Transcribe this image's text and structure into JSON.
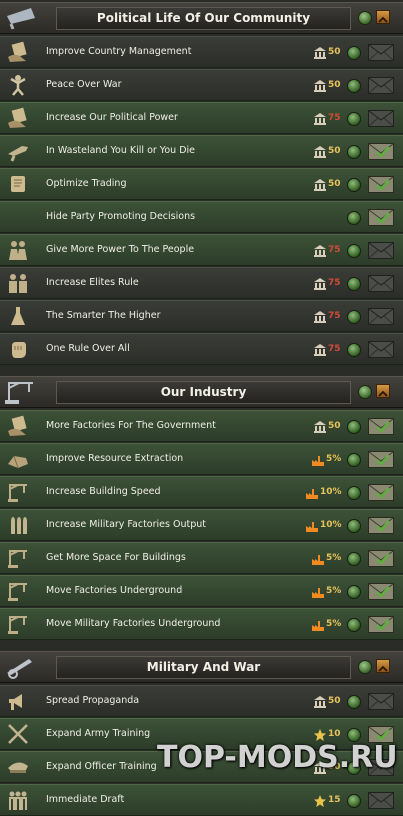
{
  "sections": [
    {
      "title": "Political Life Of Our Community",
      "emblem": "speaker-emblem-icon",
      "rows": [
        {
          "label": "Improve Country Management",
          "icon": "hand-document-icon",
          "cost_icon": "political-power-icon",
          "cost": "50",
          "cost_color": "#e5c25b",
          "envelope": "closed",
          "alt": true
        },
        {
          "label": "Peace Over War",
          "icon": "peace-figure-icon",
          "cost_icon": "political-power-icon",
          "cost": "50",
          "cost_color": "#e5c25b",
          "envelope": "closed",
          "alt": true
        },
        {
          "label": "Increase Our Political Power",
          "icon": "hand-document-icon",
          "cost_icon": "political-power-icon",
          "cost": "75",
          "cost_color": "#d24a38",
          "envelope": "closed",
          "alt": false
        },
        {
          "label": "In Wasteland You Kill or You Die",
          "icon": "weapon-icon",
          "cost_icon": "political-power-icon",
          "cost": "50",
          "cost_color": "#e5c25b",
          "envelope": "open",
          "alt": false
        },
        {
          "label": "Optimize Trading",
          "icon": "scroll-icon",
          "cost_icon": "political-power-icon",
          "cost": "50",
          "cost_color": "#e5c25b",
          "envelope": "open",
          "alt": false
        },
        {
          "label": "Hide Party Promoting Decisions",
          "icon": "",
          "cost_icon": "",
          "cost": "",
          "cost_color": "#e5c25b",
          "envelope": "open",
          "alt": false
        },
        {
          "label": "Give More Power To The People",
          "icon": "crowd-icon",
          "cost_icon": "political-power-icon",
          "cost": "75",
          "cost_color": "#d24a38",
          "envelope": "closed",
          "alt": false
        },
        {
          "label": "Increase Elites Rule",
          "icon": "elite-figures-icon",
          "cost_icon": "political-power-icon",
          "cost": "75",
          "cost_color": "#d24a38",
          "envelope": "closed",
          "alt": true
        },
        {
          "label": "The Smarter The Higher",
          "icon": "flask-icon",
          "cost_icon": "political-power-icon",
          "cost": "75",
          "cost_color": "#d24a38",
          "envelope": "closed",
          "alt": true
        },
        {
          "label": "One Rule Over All",
          "icon": "fist-icon",
          "cost_icon": "political-power-icon",
          "cost": "75",
          "cost_color": "#d24a38",
          "envelope": "closed",
          "alt": true
        }
      ]
    },
    {
      "title": "Our Industry",
      "emblem": "factory-crane-emblem-icon",
      "rows": [
        {
          "label": "More Factories For The Government",
          "icon": "hand-document-icon",
          "cost_icon": "political-power-icon",
          "cost": "50",
          "cost_color": "#e5c25b",
          "envelope": "open",
          "alt": false
        },
        {
          "label": "Improve Resource Extraction",
          "icon": "ore-icon",
          "cost_icon": "factory-icon",
          "cost": "5%",
          "cost_color": "#e5c25b",
          "envelope": "open",
          "alt": false
        },
        {
          "label": "Increase Building Speed",
          "icon": "crane-icon",
          "cost_icon": "factory-icon",
          "cost": "10%",
          "cost_color": "#e5c25b",
          "envelope": "open",
          "alt": false
        },
        {
          "label": "Increase Military Factories Output",
          "icon": "shells-icon",
          "cost_icon": "factory-icon",
          "cost": "10%",
          "cost_color": "#e5c25b",
          "envelope": "open",
          "alt": false
        },
        {
          "label": "Get More Space For Buildings",
          "icon": "crane-icon",
          "cost_icon": "factory-icon",
          "cost": "5%",
          "cost_color": "#e5c25b",
          "envelope": "open",
          "alt": false
        },
        {
          "label": "Move Factories Underground",
          "icon": "crane-icon",
          "cost_icon": "factory-icon",
          "cost": "5%",
          "cost_color": "#e5c25b",
          "envelope": "open",
          "alt": false
        },
        {
          "label": "Move Military Factories Underground",
          "icon": "crane-icon",
          "cost_icon": "factory-icon",
          "cost": "5%",
          "cost_color": "#e5c25b",
          "envelope": "open",
          "alt": false
        }
      ]
    },
    {
      "title": "Military And War",
      "emblem": "artillery-emblem-icon",
      "rows": [
        {
          "label": "Spread Propaganda",
          "icon": "speaker-icon",
          "cost_icon": "political-power-icon",
          "cost": "50",
          "cost_color": "#e5c25b",
          "envelope": "closed",
          "alt": true
        },
        {
          "label": "Expand Army Training",
          "icon": "crossed-rifles-icon",
          "cost_icon": "army-xp-star-icon",
          "cost": "10",
          "cost_color": "#e5c25b",
          "envelope": "open",
          "alt": false
        },
        {
          "label": "Expand Officer Training",
          "icon": "officer-cap-icon",
          "cost_icon": "political-power-icon",
          "cost": "50",
          "cost_color": "#e5c25b",
          "envelope": "closed",
          "alt": false
        },
        {
          "label": "Immediate Draft",
          "icon": "soldiers-icon",
          "cost_icon": "army-xp-star-icon",
          "cost": "15",
          "cost_color": "#e5c25b",
          "envelope": "closed",
          "alt": false
        }
      ]
    }
  ],
  "watermark": "TOP-MODS.RU"
}
